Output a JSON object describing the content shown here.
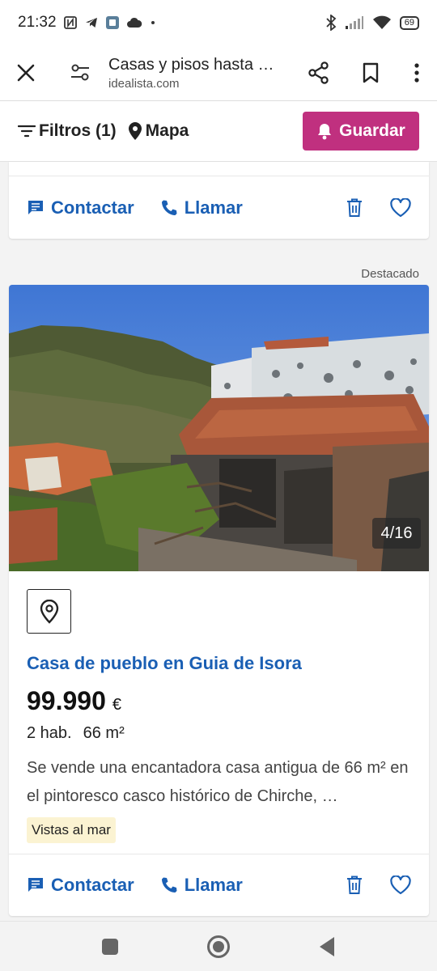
{
  "status": {
    "time": "21:32",
    "battery": "69",
    "icons": [
      "nfc-icon",
      "telegram-icon",
      "app-icon",
      "cloud-icon",
      "dot-icon",
      "bluetooth-icon",
      "signal-icon",
      "wifi-icon",
      "battery-icon"
    ]
  },
  "browser": {
    "title": "Casas y pisos hasta …",
    "url": "idealista.com"
  },
  "filters": {
    "filtros_label": "Filtros (1)",
    "mapa_label": "Mapa",
    "guardar_label": "Guardar"
  },
  "actions": {
    "contact_label": "Contactar",
    "call_label": "Llamar"
  },
  "featured_label": "Destacado",
  "listing": {
    "image_counter": "4/16",
    "title": "Casa de pueblo en Guia de Isora",
    "price": "99.990",
    "currency": "€",
    "rooms": "2 hab.",
    "size": "66 m²",
    "description": "Se vende una encantadora casa antigua de 66 m² en el pintoresco casco histórico de Chirche, …",
    "tag": "Vistas al mar"
  },
  "colors": {
    "accent_blue": "#1a5fb4",
    "brand_magenta": "#c0307f",
    "tag_bg": "#fbf3d2"
  }
}
